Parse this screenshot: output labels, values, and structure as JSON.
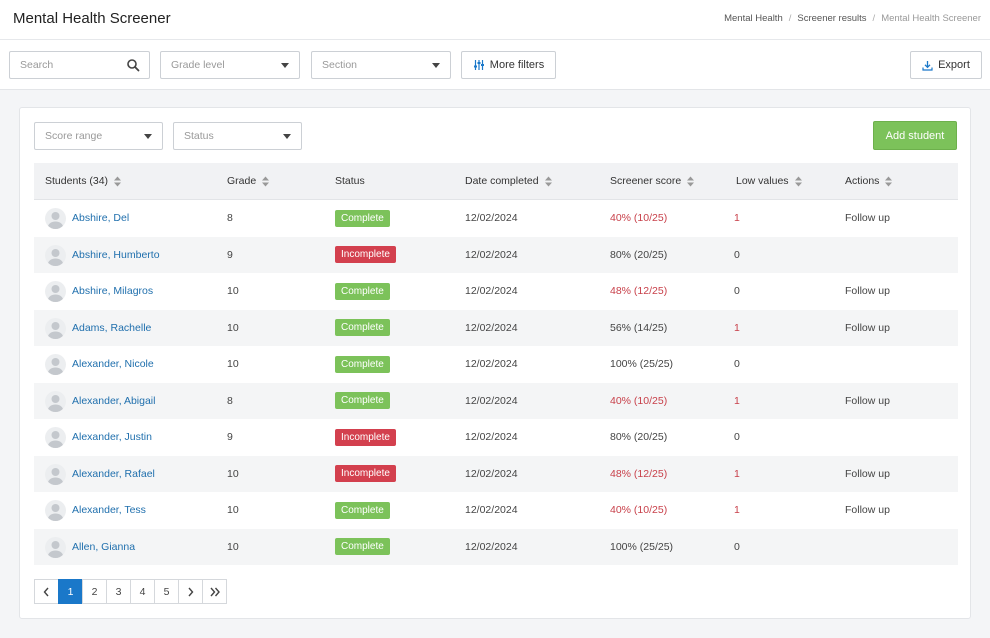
{
  "header": {
    "title": "Mental Health Screener",
    "breadcrumb": [
      "Mental Health",
      "Screener results",
      "Mental Health Screener"
    ]
  },
  "filters": {
    "search_placeholder": "Search",
    "grade_level": "Grade level",
    "section": "Section",
    "more_filters": "More filters",
    "export": "Export"
  },
  "card": {
    "score_range": "Score range",
    "status": "Status",
    "add_student": "Add student"
  },
  "table": {
    "columns": [
      "Students (34)",
      "Grade",
      "Status",
      "Date completed",
      "Screener score",
      "Low values",
      "Actions"
    ],
    "rows": [
      {
        "name": "Abshire, Del",
        "grade": "8",
        "status": "Complete",
        "date": "12/02/2024",
        "score": "40% (10/25)",
        "low": "1",
        "action": "Follow up",
        "score_alert": true,
        "low_alert": true
      },
      {
        "name": "Abshire, Humberto",
        "grade": "9",
        "status": "Incomplete",
        "date": "12/02/2024",
        "score": "80% (20/25)",
        "low": "0",
        "action": "",
        "score_alert": false,
        "low_alert": false
      },
      {
        "name": "Abshire, Milagros",
        "grade": "10",
        "status": "Complete",
        "date": "12/02/2024",
        "score": "48% (12/25)",
        "low": "0",
        "action": "Follow up",
        "score_alert": true,
        "low_alert": false
      },
      {
        "name": "Adams, Rachelle",
        "grade": "10",
        "status": "Complete",
        "date": "12/02/2024",
        "score": "56% (14/25)",
        "low": "1",
        "action": "Follow up",
        "score_alert": false,
        "low_alert": true
      },
      {
        "name": "Alexander, Nicole",
        "grade": "10",
        "status": "Complete",
        "date": "12/02/2024",
        "score": "100% (25/25)",
        "low": "0",
        "action": "",
        "score_alert": false,
        "low_alert": false
      },
      {
        "name": "Alexander, Abigail",
        "grade": "8",
        "status": "Complete",
        "date": "12/02/2024",
        "score": "40% (10/25)",
        "low": "1",
        "action": "Follow up",
        "score_alert": true,
        "low_alert": true
      },
      {
        "name": "Alexander, Justin",
        "grade": "9",
        "status": "Incomplete",
        "date": "12/02/2024",
        "score": "80% (20/25)",
        "low": "0",
        "action": "",
        "score_alert": false,
        "low_alert": false
      },
      {
        "name": "Alexander, Rafael",
        "grade": "10",
        "status": "Incomplete",
        "date": "12/02/2024",
        "score": "48% (12/25)",
        "low": "1",
        "action": "Follow up",
        "score_alert": true,
        "low_alert": true
      },
      {
        "name": "Alexander, Tess",
        "grade": "10",
        "status": "Complete",
        "date": "12/02/2024",
        "score": "40% (10/25)",
        "low": "1",
        "action": "Follow up",
        "score_alert": true,
        "low_alert": true
      },
      {
        "name": "Allen, Gianna",
        "grade": "10",
        "status": "Complete",
        "date": "12/02/2024",
        "score": "100% (25/25)",
        "low": "0",
        "action": "",
        "score_alert": false,
        "low_alert": false
      }
    ]
  },
  "pagination": {
    "pages": [
      "1",
      "2",
      "3",
      "4",
      "5"
    ],
    "current": "1"
  },
  "colors": {
    "accent": "#1a78c9",
    "complete": "#7cc25a",
    "incomplete": "#d3404e",
    "alert_text": "#c8404a",
    "link": "#1f6fad"
  }
}
